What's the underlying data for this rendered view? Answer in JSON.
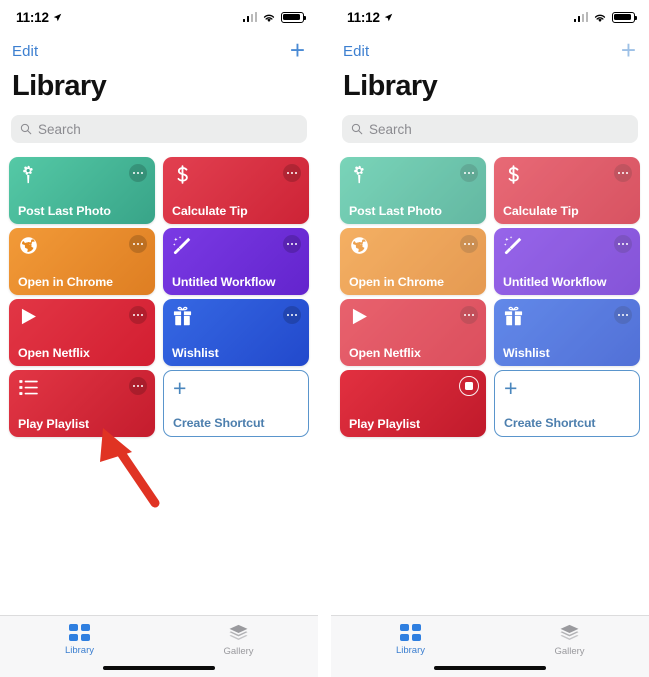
{
  "status_bar": {
    "time": "11:12",
    "location_icon": "location-arrow-icon",
    "signal_icon": "cellular-signal-icon",
    "wifi_icon": "wifi-icon",
    "battery_icon": "battery-full-icon"
  },
  "nav": {
    "edit_label": "Edit",
    "add_label": "+",
    "add_icon": "plus-icon"
  },
  "page_title": "Library",
  "search": {
    "placeholder": "Search",
    "icon": "search-icon"
  },
  "tiles": [
    {
      "label": "Post Last Photo",
      "icon": "gear-flower-icon",
      "color_start": "#4fc4a0",
      "color_end": "#3ca98e",
      "menu": "ellipsis-button"
    },
    {
      "label": "Calculate Tip",
      "icon": "dollar-sign-icon",
      "color_start": "#e03a4a",
      "color_end": "#cf2638",
      "menu": "ellipsis-button"
    },
    {
      "label": "Open in Chrome",
      "icon": "globe-icon",
      "color_start": "#f09333",
      "color_end": "#e08023",
      "menu": "ellipsis-button"
    },
    {
      "label": "Untitled Workflow",
      "icon": "magic-wand-icon",
      "color_start": "#7434e0",
      "color_end": "#6526cf",
      "menu": "ellipsis-button"
    },
    {
      "label": "Open Netflix",
      "icon": "play-triangle-icon",
      "color_start": "#e03040",
      "color_end": "#d42032",
      "menu": "ellipsis-button"
    },
    {
      "label": "Wishlist",
      "icon": "gift-box-icon",
      "color_start": "#2f62e0",
      "color_end": "#2450d0",
      "menu": "ellipsis-button"
    },
    {
      "label": "Play Playlist",
      "icon": "list-bullet-icon",
      "color_start": "#e03040",
      "color_end": "#c81f30",
      "menu": "ellipsis-button"
    }
  ],
  "create_tile": {
    "label": "Create Shortcut",
    "icon": "plus-icon",
    "border_color": "#5a95cc",
    "text_color": "#4d7fae"
  },
  "right_screen": {
    "running_tile_label": "Play Playlist",
    "running_tile_control": "stop-button",
    "dimmed": true
  },
  "tabbar": {
    "tabs": [
      {
        "label": "Library",
        "icon": "grid-squares-icon",
        "active": true
      },
      {
        "label": "Gallery",
        "icon": "stacked-layers-icon",
        "active": false
      }
    ],
    "active_color": "#3c7fd0",
    "inactive_color": "#9a9a9e"
  },
  "annotation": {
    "arrow_icon": "red-arrow-icon",
    "arrow_color": "#e03323",
    "points_to": "Play Playlist"
  }
}
